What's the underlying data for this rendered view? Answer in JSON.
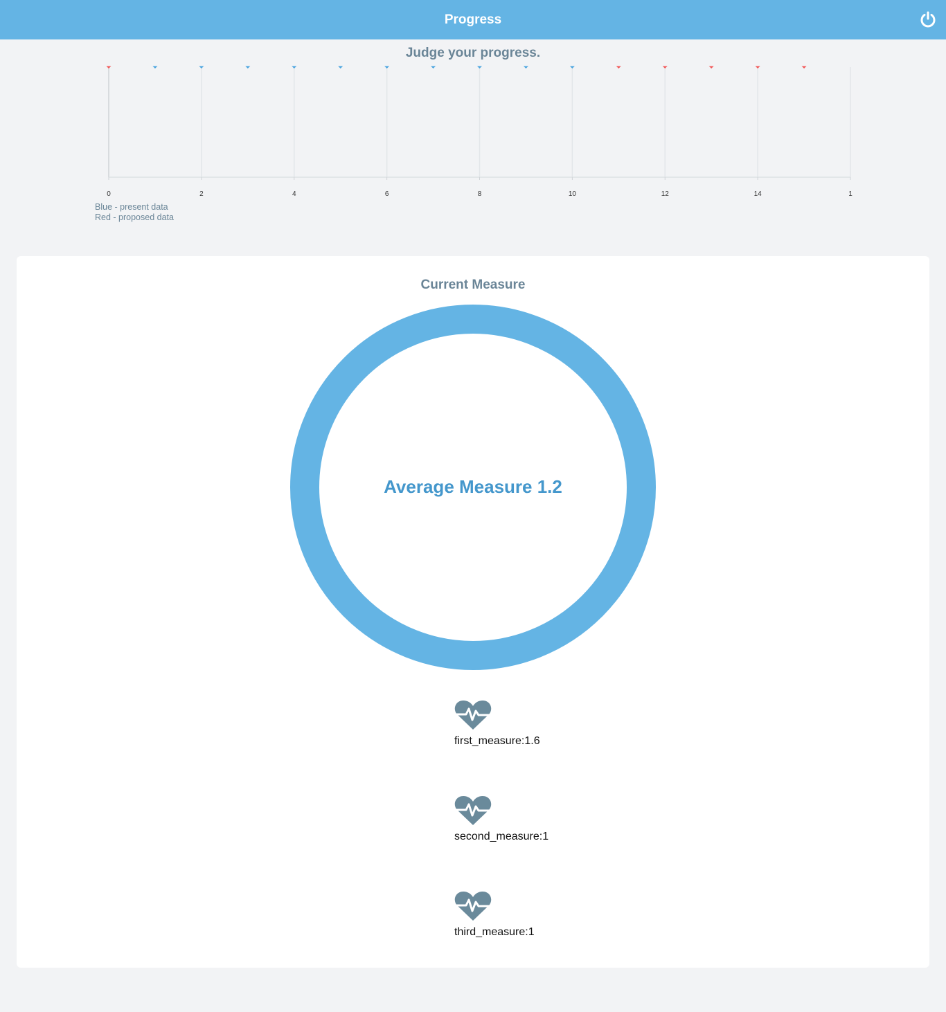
{
  "header": {
    "title": "Progress",
    "power_icon": "power-icon",
    "color": "#64b4e4"
  },
  "progress_chart": {
    "title": "Judge your progress.",
    "legend": {
      "blue": "Blue - present data",
      "red": "Red - proposed data"
    }
  },
  "chart_data": {
    "type": "scatter",
    "title": "Judge your progress.",
    "xlim": [
      0,
      16
    ],
    "x_ticks": [
      "0",
      "2",
      "4",
      "6",
      "8",
      "10",
      "12",
      "14",
      "1"
    ],
    "series": [
      {
        "color": "#4da6e0",
        "x": [
          1,
          2,
          3,
          4,
          5,
          6,
          7,
          8,
          9,
          10
        ],
        "y": [
          0,
          0,
          0,
          0,
          0,
          0,
          0,
          0,
          0,
          0
        ]
      },
      {
        "color": "#f25a5a",
        "x": [
          0,
          11,
          12,
          13,
          14,
          15
        ],
        "y": [
          0,
          0,
          0,
          0,
          0,
          0
        ]
      }
    ],
    "grid": true
  },
  "current_measure": {
    "title": "Current Measure",
    "average_label": "Average Measure 1.2",
    "ring_color": "#64b4e4",
    "items": [
      {
        "icon": "heartbeat-icon",
        "label": "first_measure:1.6"
      },
      {
        "icon": "heartbeat-icon",
        "label": "second_measure:1"
      },
      {
        "icon": "heartbeat-icon",
        "label": "third_measure:1"
      }
    ]
  }
}
